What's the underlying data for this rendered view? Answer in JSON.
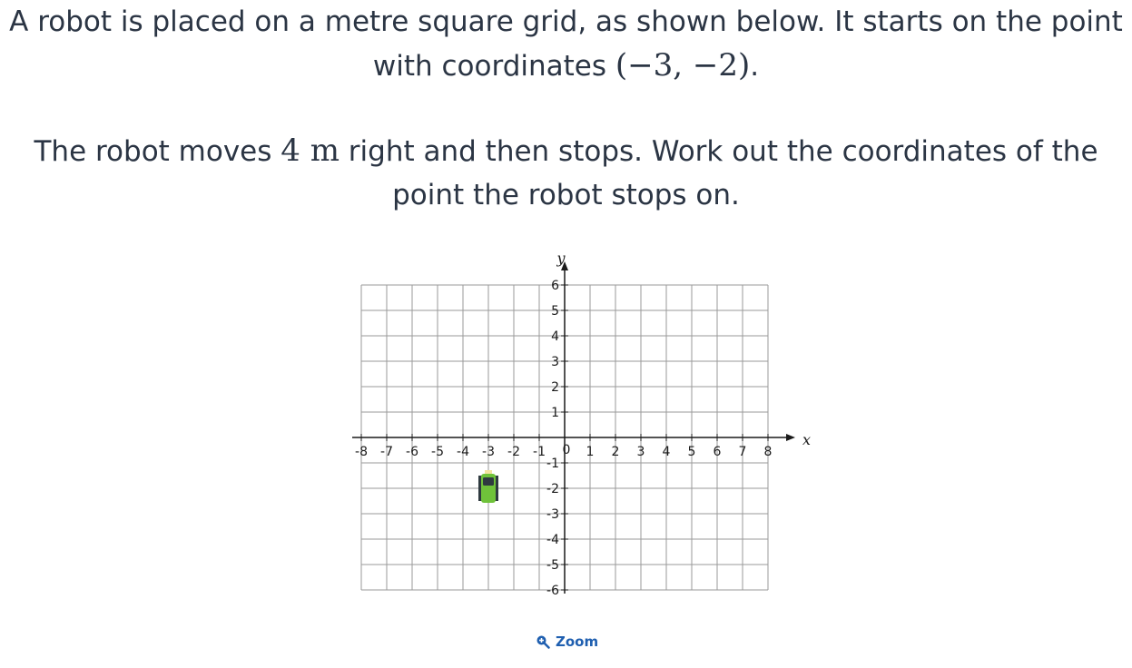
{
  "question": {
    "line1_text": "A robot is placed on a metre square grid, as shown below. It starts on the point with coordinates ",
    "start_coords": "(−3, −2)",
    "line1_end": ".",
    "line2_pre": "The robot moves ",
    "distance": "4 m",
    "line2_post": " right and then stops. Work out the coordinates of the point the robot stops on."
  },
  "chart_data": {
    "type": "scatter",
    "xlabel": "x",
    "ylabel": "y",
    "xlim": [
      -8,
      8
    ],
    "ylim": [
      -6,
      6
    ],
    "x_ticks": [
      "-8",
      "-7",
      "-6",
      "-5",
      "-4",
      "-3",
      "-2",
      "-1",
      "1",
      "2",
      "3",
      "4",
      "5",
      "6",
      "7",
      "8"
    ],
    "y_ticks": [
      "6",
      "5",
      "4",
      "3",
      "2",
      "1",
      "-1",
      "-2",
      "-3",
      "-4",
      "-5",
      "-6"
    ],
    "origin_label": "0",
    "grid": true,
    "robot": {
      "x": -3,
      "y": -2
    },
    "colors": {
      "grid": "#9a9a9a",
      "axis": "#1a1a1a",
      "robot_body": "#6fc23a",
      "robot_dark": "#2f3a40"
    }
  },
  "zoom": {
    "label": "Zoom",
    "icon": "zoom-in-icon"
  }
}
